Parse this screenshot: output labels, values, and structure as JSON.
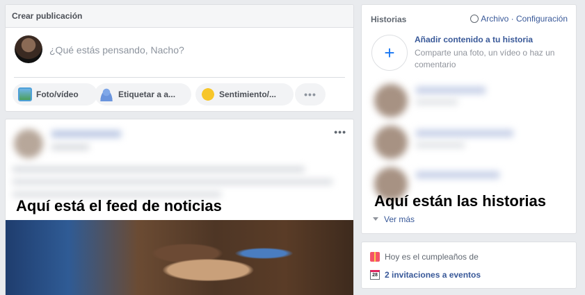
{
  "composer": {
    "title": "Crear publicación",
    "placeholder": "¿Qué estás pensando, Nacho?",
    "actions": [
      {
        "label": "Foto/vídeo",
        "icon": "photo-icon"
      },
      {
        "label": "Etiquetar a a...",
        "icon": "tag-friends-icon"
      },
      {
        "label": "Sentimiento/...",
        "icon": "feeling-icon"
      }
    ],
    "more_label": "•••"
  },
  "feed": {
    "caption": "Aquí está el feed de noticias",
    "more_label": "•••"
  },
  "stories": {
    "title": "Historias",
    "archive_label": "Archivo",
    "separator": " · ",
    "settings_label": "Configuración",
    "add_icon": "+",
    "add_title": "Añadir contenido a tu historia",
    "add_subtitle": "Comparte una foto, un vídeo o haz un comentario",
    "caption": "Aquí están las historias",
    "see_more_label": "Ver más"
  },
  "events": {
    "birthday_text": "Hoy es el cumpleaños de",
    "calendar_day": "28",
    "invitations_text": "2 invitaciones a eventos"
  },
  "colors": {
    "background": "#e9ebee",
    "link": "#385898",
    "accent": "#1877f2"
  }
}
